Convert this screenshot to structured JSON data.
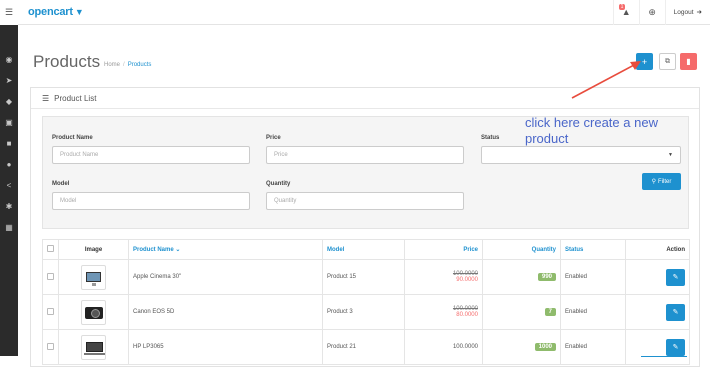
{
  "header": {
    "logo": "opencart",
    "notification_count": "1",
    "logout_label": "Logout"
  },
  "page": {
    "title": "Products",
    "breadcrumb": [
      "Home",
      "Products"
    ]
  },
  "annotation": "click here create a new product",
  "panel": {
    "heading": "Product List"
  },
  "filter": {
    "product_name_label": "Product Name",
    "product_name_placeholder": "Product Name",
    "price_label": "Price",
    "price_placeholder": "Price",
    "status_label": "Status",
    "model_label": "Model",
    "model_placeholder": "Model",
    "quantity_label": "Quantity",
    "quantity_placeholder": "Quantity",
    "button_label": "Filter"
  },
  "table": {
    "headers": {
      "image": "Image",
      "name": "Product Name",
      "model": "Model",
      "price": "Price",
      "quantity": "Quantity",
      "status": "Status",
      "action": "Action"
    },
    "rows": [
      {
        "name": "Apple Cinema 30\"",
        "model": "Product 15",
        "price": "100.0000",
        "special": "90.0000",
        "quantity": "990",
        "status": "Enabled",
        "image_icon": "monitor-icon"
      },
      {
        "name": "Canon EOS 5D",
        "model": "Product 3",
        "price": "100.0000",
        "special": "80.0000",
        "quantity": "7",
        "status": "Enabled",
        "image_icon": "camera-icon"
      },
      {
        "name": "HP LP3065",
        "model": "Product 21",
        "price": "100.0000",
        "special": "",
        "quantity": "1000",
        "status": "Enabled",
        "image_icon": "laptop-icon"
      }
    ]
  },
  "colors": {
    "primary": "#1e91cf",
    "danger": "#f56b6b",
    "success": "#8fbb6c",
    "sidebar": "#2b2b2b",
    "annotation": "#4a66c9",
    "arrow": "#e84c3d"
  }
}
